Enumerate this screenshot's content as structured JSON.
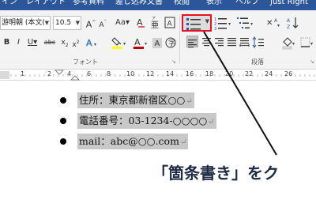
{
  "tabs": [
    {
      "label": "イン"
    },
    {
      "label": "レイアウト"
    },
    {
      "label": "参考資料"
    },
    {
      "label": "差し込み文書"
    },
    {
      "label": "校閲"
    },
    {
      "label": "表示"
    },
    {
      "label": "ヘルプ"
    },
    {
      "label": "Just Right"
    }
  ],
  "ribbon": {
    "font_name": "游明朝 (本文(",
    "font_size": "10.5",
    "font_group_label": "フォント",
    "paragraph_group_label": "段落",
    "highlighted_button": "bullets",
    "font_color": "#c00000",
    "highlight_color": "#ffff00"
  },
  "ruler": {
    "numbers": [
      "1",
      "2",
      "4",
      "6",
      "8",
      "10",
      "12",
      "14",
      "16",
      "18",
      "20",
      "22",
      "24",
      "26"
    ]
  },
  "document": {
    "lines": [
      {
        "text": "住所：東京都新宿区○○"
      },
      {
        "text": "電話番号：03-1234-○○○○"
      },
      {
        "text": "mail：abc@○○.com"
      }
    ],
    "paragraph_mark": "↵"
  },
  "callout": "「箇条書き」をク"
}
